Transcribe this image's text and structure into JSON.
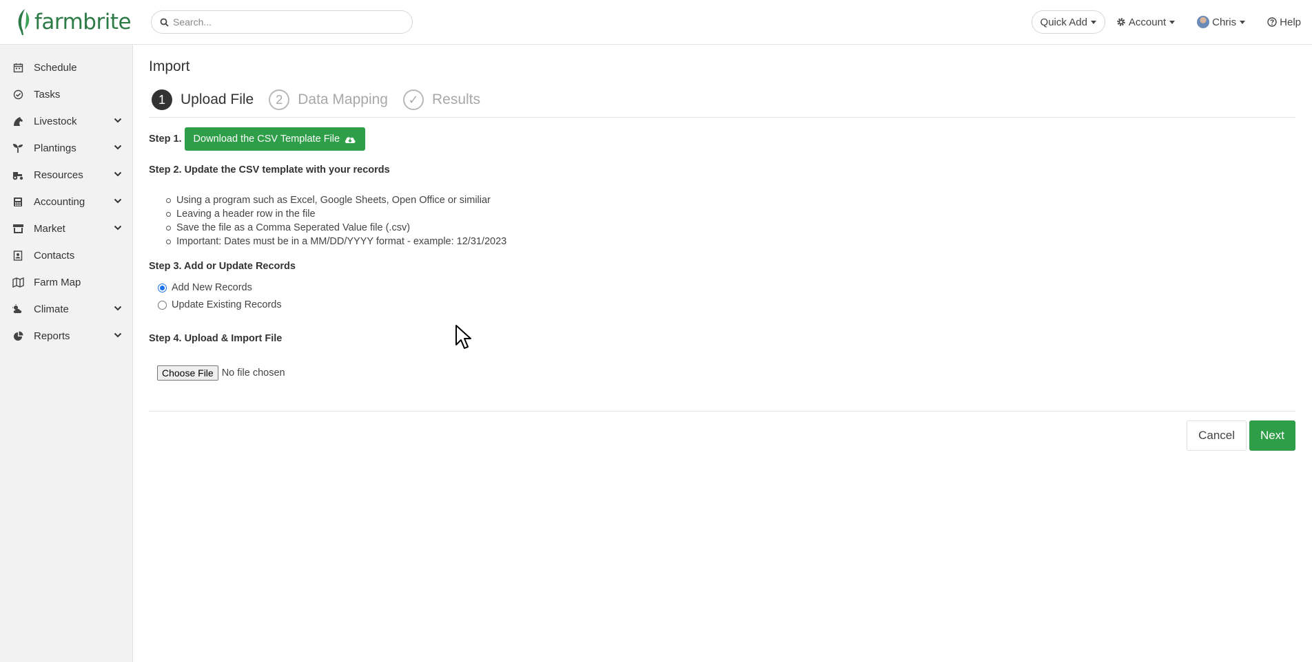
{
  "brand": {
    "logo_text": "farmbrite",
    "accent": "#2f9e48"
  },
  "header": {
    "search_placeholder": "Search...",
    "quick_add": "Quick Add",
    "account": "Account",
    "user": "Chris",
    "help": "Help"
  },
  "sidebar": {
    "items": [
      {
        "label": "Schedule",
        "icon": "calendar-icon",
        "expandable": false
      },
      {
        "label": "Tasks",
        "icon": "check-circle-icon",
        "expandable": false
      },
      {
        "label": "Livestock",
        "icon": "horse-icon",
        "expandable": true
      },
      {
        "label": "Plantings",
        "icon": "seedling-icon",
        "expandable": true
      },
      {
        "label": "Resources",
        "icon": "tractor-icon",
        "expandable": true
      },
      {
        "label": "Accounting",
        "icon": "calculator-icon",
        "expandable": true
      },
      {
        "label": "Market",
        "icon": "store-icon",
        "expandable": true
      },
      {
        "label": "Contacts",
        "icon": "address-book-icon",
        "expandable": false
      },
      {
        "label": "Farm Map",
        "icon": "map-icon",
        "expandable": false
      },
      {
        "label": "Climate",
        "icon": "cloud-sun-icon",
        "expandable": true
      },
      {
        "label": "Reports",
        "icon": "pie-chart-icon",
        "expandable": true
      }
    ]
  },
  "page": {
    "title": "Import",
    "wizard": [
      {
        "num": "1",
        "label": "Upload File",
        "state": "active"
      },
      {
        "num": "2",
        "label": "Data Mapping",
        "state": "inactive"
      },
      {
        "num": "✓",
        "label": "Results",
        "state": "inactive"
      }
    ],
    "step1": {
      "heading": "Step 1.",
      "button": "Download the CSV Template File"
    },
    "step2": {
      "heading": "Step 2. Update the CSV template with your records",
      "bullets": [
        "Using a program such as Excel, Google Sheets, Open Office or similiar",
        "Leaving a header row in the file",
        "Save the file as a Comma Seperated Value file (.csv)",
        "Important: Dates must be in a MM/DD/YYYY format - example: 12/31/2023"
      ]
    },
    "step3": {
      "heading": "Step 3. Add or Update Records",
      "options": [
        {
          "label": "Add New Records",
          "checked": true
        },
        {
          "label": "Update Existing Records",
          "checked": false
        }
      ]
    },
    "step4": {
      "heading": "Step 4. Upload & Import File",
      "choose_button": "Choose File",
      "file_status": "No file chosen"
    },
    "actions": {
      "cancel": "Cancel",
      "next": "Next"
    }
  }
}
